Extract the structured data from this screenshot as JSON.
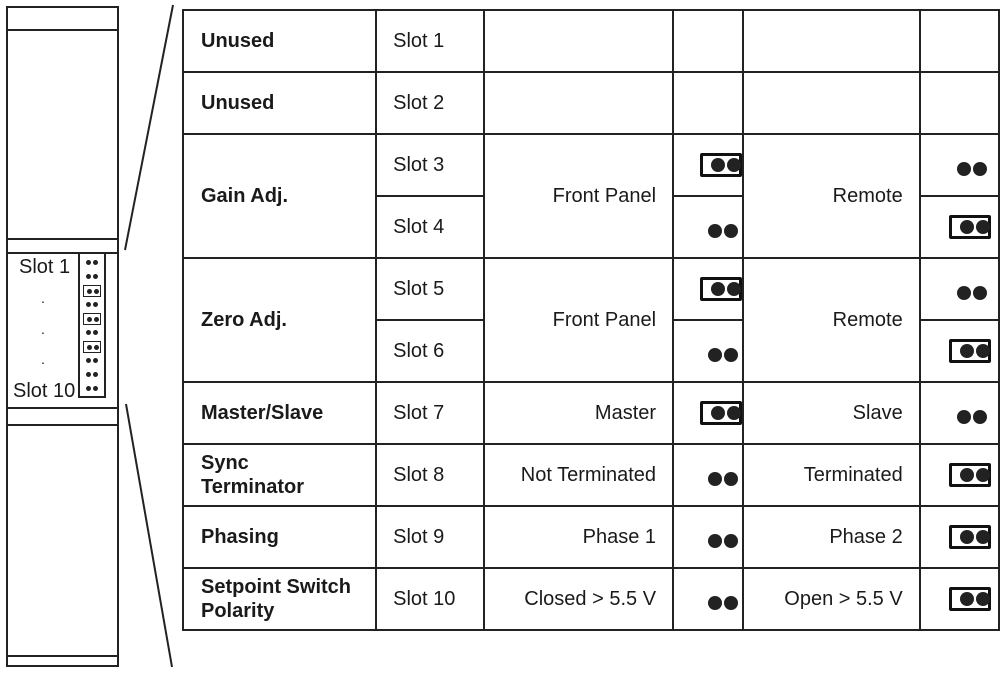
{
  "left_panel": {
    "first_slot_label": "Slot 1",
    "last_slot_label": "Slot 10",
    "ellipsis": ".",
    "jumper_strip": [
      {
        "slot": 1,
        "installed": false
      },
      {
        "slot": 2,
        "installed": false
      },
      {
        "slot": 3,
        "installed": true
      },
      {
        "slot": 4,
        "installed": false
      },
      {
        "slot": 5,
        "installed": true
      },
      {
        "slot": 6,
        "installed": false
      },
      {
        "slot": 7,
        "installed": true
      },
      {
        "slot": 8,
        "installed": false
      },
      {
        "slot": 9,
        "installed": false
      },
      {
        "slot": 10,
        "installed": false
      }
    ]
  },
  "table": {
    "rows": [
      {
        "function": "Unused",
        "slots": [
          {
            "slot": "Slot 1",
            "opt_a_jumper": null,
            "opt_b_jumper": null
          }
        ],
        "option_a": "",
        "option_b": ""
      },
      {
        "function": "Unused",
        "slots": [
          {
            "slot": "Slot 2",
            "opt_a_jumper": null,
            "opt_b_jumper": null
          }
        ],
        "option_a": "",
        "option_b": ""
      },
      {
        "function": "Gain Adj.",
        "option_a": "Front Panel",
        "option_b": "Remote",
        "slots": [
          {
            "slot": "Slot 3",
            "opt_a_jumper": "installed",
            "opt_b_jumper": "open"
          },
          {
            "slot": "Slot 4",
            "opt_a_jumper": "open",
            "opt_b_jumper": "installed"
          }
        ]
      },
      {
        "function": "Zero Adj.",
        "option_a": "Front Panel",
        "option_b": "Remote",
        "slots": [
          {
            "slot": "Slot 5",
            "opt_a_jumper": "installed",
            "opt_b_jumper": "open"
          },
          {
            "slot": "Slot 6",
            "opt_a_jumper": "open",
            "opt_b_jumper": "installed"
          }
        ]
      },
      {
        "function": "Master/Slave",
        "option_a": "Master",
        "option_b": "Slave",
        "slots": [
          {
            "slot": "Slot 7",
            "opt_a_jumper": "installed",
            "opt_b_jumper": "open"
          }
        ]
      },
      {
        "function": "Sync Terminator",
        "option_a": "Not Terminated",
        "option_b": "Terminated",
        "slots": [
          {
            "slot": "Slot 8",
            "opt_a_jumper": "open",
            "opt_b_jumper": "installed"
          }
        ]
      },
      {
        "function": "Phasing",
        "option_a": "Phase 1",
        "option_b": "Phase 2",
        "slots": [
          {
            "slot": "Slot 9",
            "opt_a_jumper": "open",
            "opt_b_jumper": "installed"
          }
        ]
      },
      {
        "function": "Setpoint Switch Polarity",
        "option_a": "Closed > 5.5 V",
        "option_b": "Open > 5.5 V",
        "slots": [
          {
            "slot": "Slot 10",
            "opt_a_jumper": "open",
            "opt_b_jumper": "installed"
          }
        ]
      }
    ]
  }
}
